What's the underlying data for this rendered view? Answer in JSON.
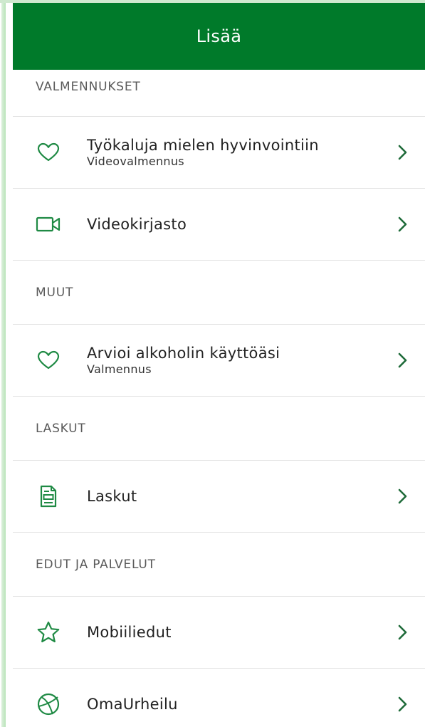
{
  "colors": {
    "brand": "#007a2a",
    "icon": "#1f8a44",
    "chevron": "#1f6b3a"
  },
  "header": {
    "title": "Lisää"
  },
  "sections": [
    {
      "title": "VALMENNUKSET",
      "items": [
        {
          "title": "Työkaluja mielen hyvinvointiin",
          "subtitle": "Videovalmennus",
          "icon": "heart-icon"
        },
        {
          "title": "Videokirjasto",
          "icon": "video-camera-icon"
        }
      ]
    },
    {
      "title": "MUUT",
      "items": [
        {
          "title": "Arvioi alkoholin käyttöäsi",
          "subtitle": "Valmennus",
          "icon": "heart-icon"
        }
      ]
    },
    {
      "title": "LASKUT",
      "items": [
        {
          "title": "Laskut",
          "icon": "invoice-icon"
        }
      ]
    },
    {
      "title": "EDUT JA PALVELUT",
      "items": [
        {
          "title": "Mobiiliedut",
          "icon": "star-icon"
        },
        {
          "title": "OmaUrheilu",
          "icon": "ball-icon"
        }
      ]
    }
  ]
}
